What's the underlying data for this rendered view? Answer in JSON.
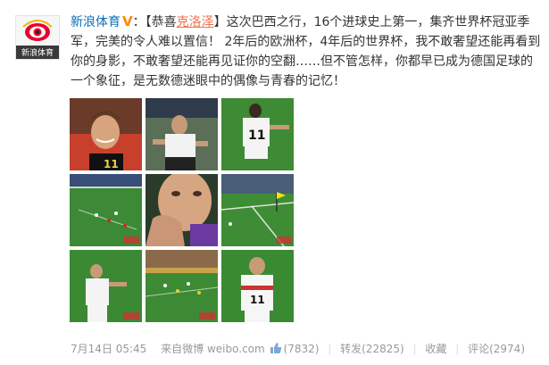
{
  "author": {
    "name": "新浪体育",
    "verified_mark": "V",
    "avatar_caption": "新浪体育",
    "colon": "："
  },
  "post": {
    "tag_open": "【恭喜",
    "tag_name": "克洛泽",
    "tag_close": "】",
    "body": "这次巴西之行，16个进球史上第一，集齐世界杯冠亚季军，完美的令人难以置信！ 2年后的欧洲杯，4年后的世界杯，我不敢奢望还能再看到你的身影，不敢奢望还能再见证你的空翻……但不管怎样，你都早已成为德国足球的一个象征，是无数德迷眼中的偶像与青春的记忆！"
  },
  "images": [
    {
      "name": "klose-smiling",
      "jersey": "11"
    },
    {
      "name": "klose-celebrating",
      "jersey": ""
    },
    {
      "name": "klose-running-back",
      "jersey": "11"
    },
    {
      "name": "field-wide-1",
      "jersey": ""
    },
    {
      "name": "closeup-face",
      "jersey": ""
    },
    {
      "name": "corner-flag",
      "jersey": ""
    },
    {
      "name": "klose-gesturing",
      "jersey": ""
    },
    {
      "name": "field-wide-2",
      "jersey": ""
    },
    {
      "name": "klose-standing",
      "jersey": "11"
    }
  ],
  "footer": {
    "time": "7月14日 05:45",
    "from_label": "来自",
    "source": "微博 weibo.com",
    "like_count": "(7832)",
    "repost_label": "转发(22825)",
    "favorite_label": "收藏",
    "comment_label": "评论(2974)",
    "separator": "|"
  },
  "colors": {
    "link": "#0a6cb9",
    "highlight": "#eb7350",
    "verified": "#ff8a00",
    "meta": "#999999"
  }
}
